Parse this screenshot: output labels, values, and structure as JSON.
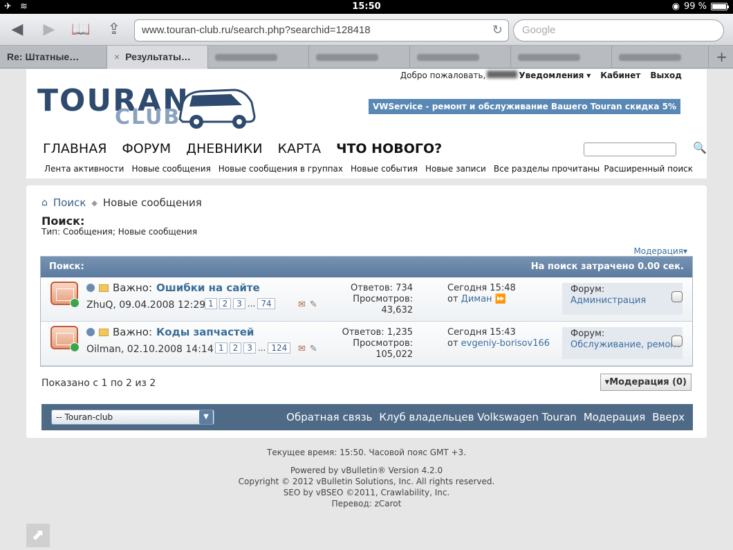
{
  "status": {
    "time": "15:50",
    "battery": "99 %",
    "icons": [
      "airplane-icon",
      "wifi-icon",
      "lock-rotation-icon"
    ]
  },
  "browser": {
    "url": "www.touran-club.ru/search.php?searchid=128418",
    "search_placeholder": "Google",
    "tabs": [
      {
        "label": "Re: Штатные…",
        "active": false
      },
      {
        "label": "Результаты…",
        "active": true,
        "close": "×"
      },
      {
        "label": "",
        "active": false
      },
      {
        "label": "",
        "active": false
      },
      {
        "label": "",
        "active": false
      },
      {
        "label": "",
        "active": false
      },
      {
        "label": "",
        "active": false
      }
    ],
    "new_tab": "+"
  },
  "header": {
    "welcome": "Добро пожаловать,",
    "notifications": "Уведомления",
    "cabinet": "Кабинет",
    "logout": "Выход",
    "logo_top": "TOURAN",
    "logo_bottom": "CLUB",
    "promo": "VWService - ремонт и обслуживание Вашего Touran скидка 5%",
    "nav": [
      "ГЛАВНАЯ",
      "ФОРУМ",
      "ДНЕВНИКИ",
      "КАРТА",
      "ЧТО НОВОГО?"
    ],
    "subnav": [
      "Лента активности",
      "Новые сообщения",
      "Новые сообщения в группах",
      "Новые события",
      "Новые записи",
      "Все разделы прочитаны"
    ],
    "advanced_search": "Расширенный поиск"
  },
  "breadcrumb": {
    "link": "Поиск",
    "current": "Новые сообщения"
  },
  "page": {
    "title": "Поиск:",
    "type": "Тип: Сообщения; Новые сообщения",
    "moderation_link": "Модерация"
  },
  "results": {
    "header_left": "Поиск:",
    "header_right": "На поиск затрачено 0.00 сек.",
    "rows": [
      {
        "prefix": "Важно:",
        "title": "Ошибки на сайте",
        "author": "ZhuQ, 09.04.2008 12:29",
        "pages": [
          "1",
          "2",
          "3",
          "...",
          "74"
        ],
        "replies": "Ответов: 734",
        "views_label": "Просмотров:",
        "views": "43,632",
        "last_time": "Сегодня 15:48",
        "last_by_prefix": "от",
        "last_by": "Диман",
        "forum_label": "Форум:",
        "forum": "Администрация"
      },
      {
        "prefix": "Важно:",
        "title": "Коды запчастей",
        "author": "Oilman, 02.10.2008 14:14",
        "pages": [
          "1",
          "2",
          "3",
          "...",
          "124"
        ],
        "replies": "Ответов: 1,235",
        "views_label": "Просмотров:",
        "views": "105,022",
        "last_time": "Сегодня 15:43",
        "last_by_prefix": "от",
        "last_by": "evgeniy-borisov166",
        "forum_label": "Форум:",
        "forum": "Обслуживание, ремонт"
      }
    ]
  },
  "summary": {
    "shown": "Показано с 1 по 2 из 2",
    "moderation_button": "Модерация (0)"
  },
  "footer": {
    "style_select": "-- Touran-club",
    "links": [
      "Обратная связь",
      "Клуб владельцев Volkswagen Touran",
      "Модерация",
      "Вверх"
    ]
  },
  "bottom": {
    "time": "Текущее время: 15:50. Часовой пояс GMT +3.",
    "powered": "Powered by vBulletin® Version 4.2.0",
    "copyright": "Copyright © 2012 vBulletin Solutions, Inc. All rights reserved.",
    "seo": "SEO by vBSEO ©2011, Crawlability, Inc.",
    "translation": "Перевод: zCarot"
  }
}
